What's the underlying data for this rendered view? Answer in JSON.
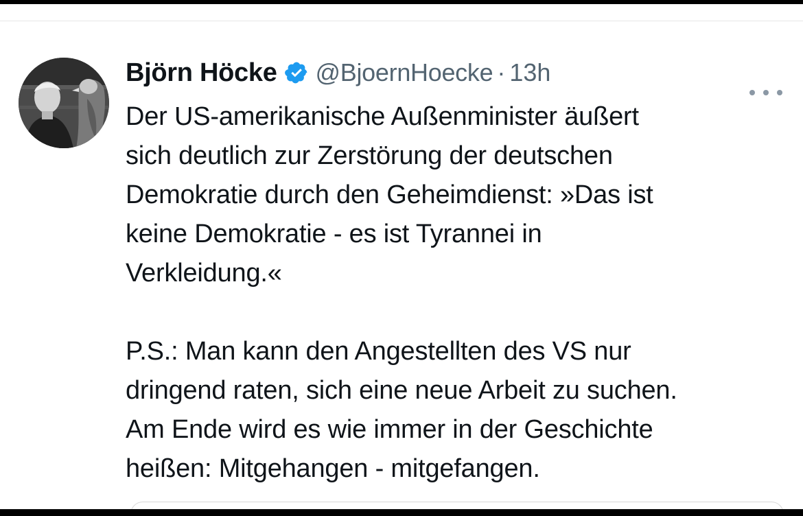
{
  "tweet": {
    "display_name": "Björn Höcke",
    "verified_icon": "verified-badge-icon",
    "handle": "@BjoernHoecke",
    "separator": "·",
    "time": "13h",
    "more_icon": "more-options-icon",
    "lines_p1": [
      "Der US-amerikanische Außenminister äußert",
      "sich deutlich zur Zerstörung der deutschen",
      "Demokratie durch den Geheimdienst:  »Das ist",
      "keine Demokratie - es ist Tyrannei in",
      "Verkleidung.«"
    ],
    "lines_p2": [
      "P.S.: Man kann den Angestellten des VS nur",
      "dringend raten, sich eine neue Arbeit zu suchen.",
      "Am Ende wird es wie immer in der Geschichte",
      "heißen: Mitgehangen - mitgefangen."
    ]
  },
  "colors": {
    "text": "#0f1419",
    "secondary": "#536471",
    "verified": "#1d9bf0"
  }
}
